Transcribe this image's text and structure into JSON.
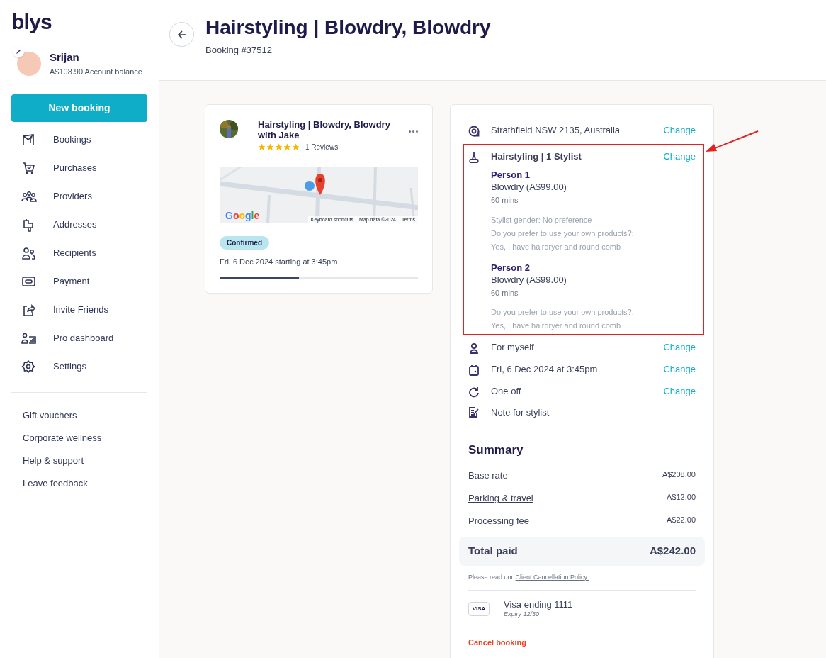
{
  "logo": "blys",
  "user": {
    "name": "Srijan",
    "balance": "A$108.90 Account balance"
  },
  "new_booking": "New booking",
  "nav": [
    {
      "label": "Bookings"
    },
    {
      "label": "Purchases"
    },
    {
      "label": "Providers"
    },
    {
      "label": "Addresses"
    },
    {
      "label": "Recipients"
    },
    {
      "label": "Payment"
    },
    {
      "label": "Invite Friends"
    },
    {
      "label": "Pro dashboard"
    },
    {
      "label": "Settings"
    }
  ],
  "links": [
    "Gift vouchers",
    "Corporate wellness",
    "Help & support",
    "Leave feedback"
  ],
  "header": {
    "title": "Hairstyling | Blowdry, Blowdry",
    "booking_number": "Booking #37512"
  },
  "booking_card": {
    "title": "Hairstyling | Blowdry, Blowdry with Jake",
    "stars": 5,
    "reviews": "1 Reviews",
    "map": {
      "kind": "picture",
      "logo": "Google",
      "attribution": [
        "Keyboard shortcuts",
        "Map data ©2024",
        "Terms"
      ]
    },
    "status": "Confirmed",
    "time": "Fri, 6 Dec 2024 starting at 3:45pm",
    "progress": {
      "level": 0.4
    }
  },
  "details": [
    {
      "kind": "address",
      "text": "Strathfield NSW 2135, Australia",
      "action": "Change"
    },
    {
      "kind": "service",
      "text": "Hairstyling | 1 Stylist",
      "action": "Change",
      "persons": [
        {
          "name": "Person 1",
          "service": "Blowdry (A$99.00)",
          "duration": "60 mins",
          "answers": [
            "Stylist gender: No preference",
            "Do you prefer to use your own products?:",
            "Yes, I have hairdryer and round comb"
          ]
        },
        {
          "name": "Person 2",
          "service": "Blowdry (A$99.00)",
          "duration": "60 mins",
          "answers": [
            "Do you prefer to use your own products?:",
            "Yes, I have hairdryer and round comb"
          ]
        }
      ]
    },
    {
      "kind": "recipient",
      "text": "For myself",
      "action": "Change"
    },
    {
      "kind": "time",
      "text": "Fri, 6 Dec 2024 at 3:45pm",
      "action": "Change"
    },
    {
      "kind": "frequency",
      "text": "One off",
      "action": "Change"
    },
    {
      "kind": "note",
      "text": "Note for stylist"
    }
  ],
  "summary": {
    "title": "Summary",
    "lines": [
      {
        "label": "Base rate",
        "amount": "A$208.00",
        "link": false
      },
      {
        "label": "Parking & travel",
        "amount": "A$12.00",
        "link": true
      },
      {
        "label": "Processing fee",
        "amount": "A$22.00",
        "link": true
      }
    ],
    "total": {
      "label": "Total paid",
      "amount": "A$242.00"
    },
    "policy": {
      "text": "Please read our",
      "link": "Client Cancellation Policy."
    }
  },
  "payment": {
    "brand": "VISA",
    "title": "Visa ending 1111",
    "expiry": "Expiry 12/30"
  },
  "cancel": "Cancel booking"
}
